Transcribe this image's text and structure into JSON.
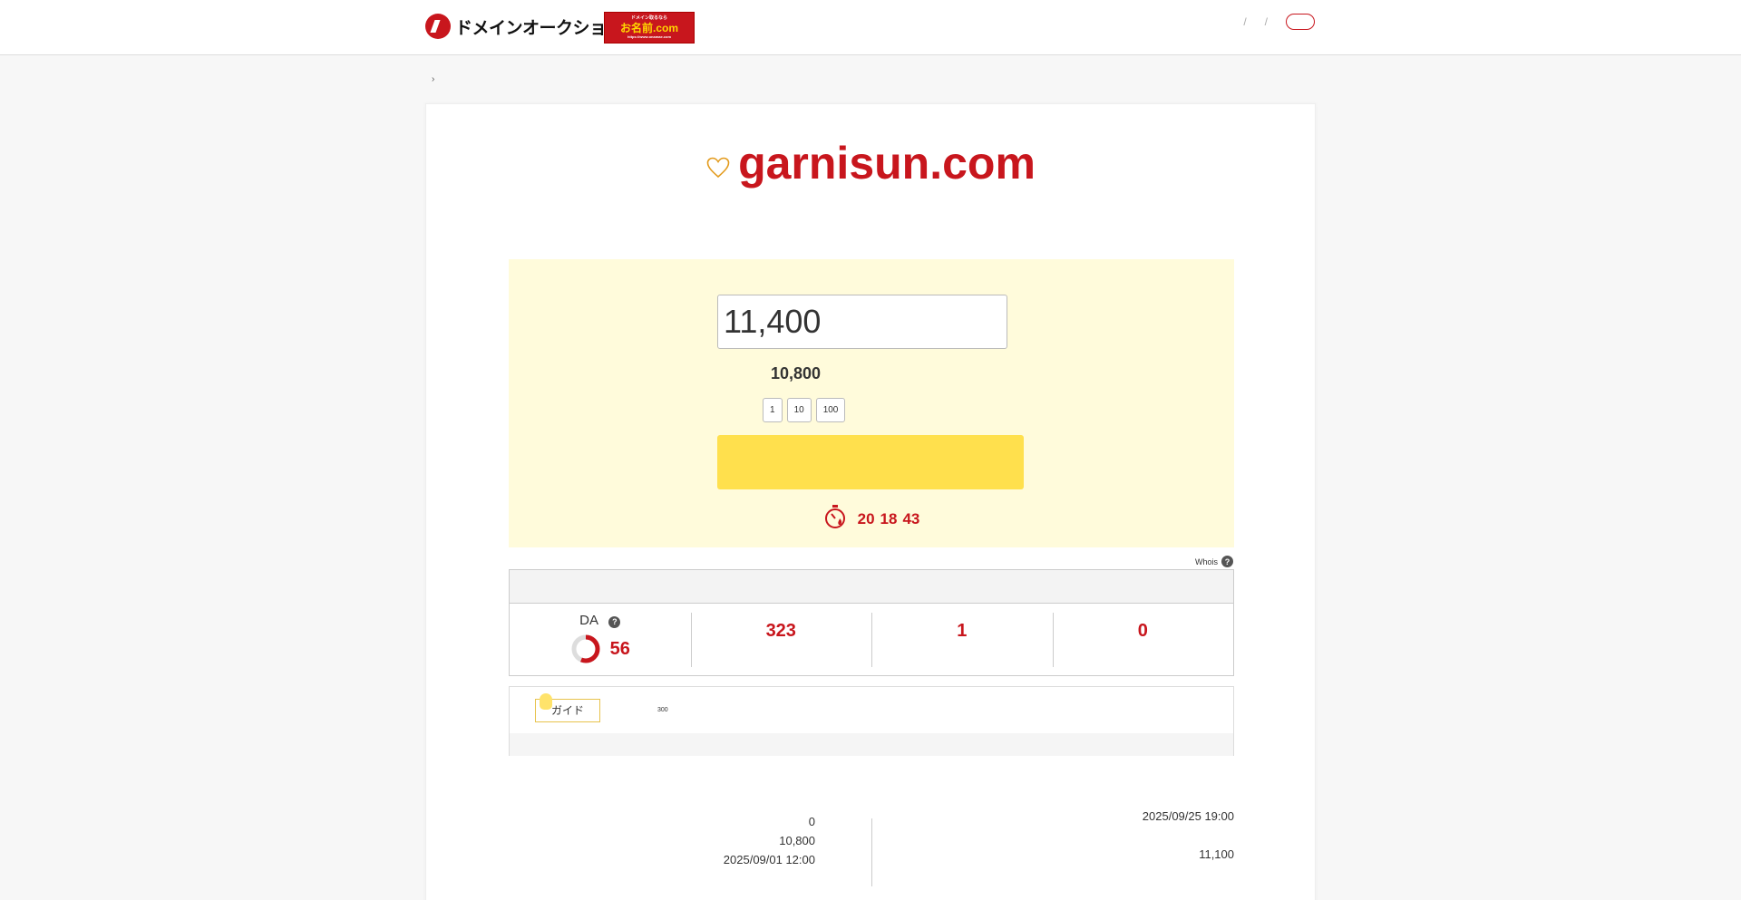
{
  "header": {
    "logo_text": "ドメインオークション",
    "banner_top": "ドメイン取るなら",
    "banner_main": "お名前.com",
    "banner_url": "https://www.onamae.com",
    "nav": [
      "",
      "",
      ""
    ],
    "login_label": ""
  },
  "breadcrumb": {
    "home": "",
    "current": ""
  },
  "domain": {
    "name": "garnisun.com"
  },
  "bid": {
    "label": "",
    "input_value": "11,400",
    "yen_suffix": "",
    "current_label": "",
    "current_value": "10,800",
    "quick_label": "",
    "quick_buttons": [
      "1",
      "10",
      "100"
    ],
    "bid_button": "",
    "timer": {
      "prefix": "",
      "days": "20",
      "hours": "18",
      "minutes": "43"
    }
  },
  "whois": {
    "text": "Whois"
  },
  "stats": {
    "items": [
      {
        "label": "DA",
        "value": "56",
        "fraction": 0.56
      },
      {
        "label": "",
        "value": "323"
      },
      {
        "label": "",
        "value": "1"
      },
      {
        "label": "",
        "value": "0"
      }
    ]
  },
  "guide": {
    "badge": "ガイド",
    "word": "",
    "text": "300",
    "link": ""
  },
  "details": {
    "title": "",
    "left": [
      {
        "key": "",
        "value": "0"
      },
      {
        "key": "",
        "value": "10,800"
      },
      {
        "key": "",
        "value": "2025/09/01   12:00"
      }
    ],
    "right": [
      {
        "key": "",
        "value": "2025/09/25   19:00"
      },
      {
        "key": "",
        "value": ""
      },
      {
        "key": "",
        "value": "11,100"
      }
    ]
  },
  "colors": {
    "accent": "#c8161d",
    "bid_bg": "#fffbdb",
    "button": "#ffe04d",
    "link": "#1a8fc8"
  }
}
